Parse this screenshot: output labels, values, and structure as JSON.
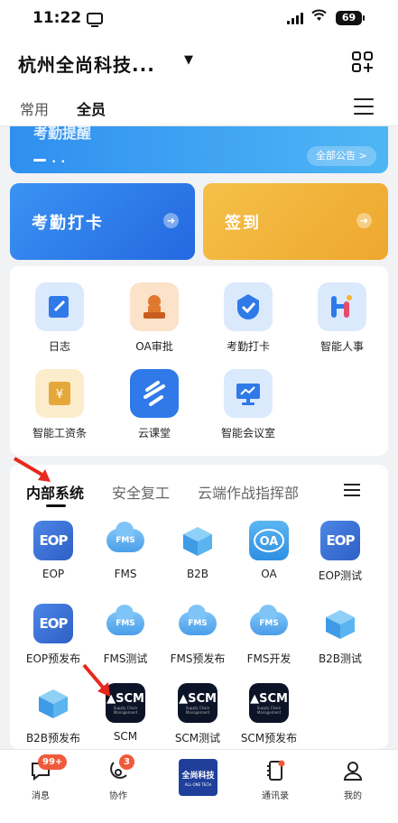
{
  "status": {
    "time": "11:22",
    "battery": "69",
    "wifi": "wifi-icon"
  },
  "header": {
    "org": "杭州全尚科技...",
    "qr_icon": "qr-add-icon"
  },
  "tabs": {
    "common": "常用",
    "all": "全员"
  },
  "banner": {
    "title": "考勤提醒",
    "all_notices": "全部公告 >"
  },
  "cards": {
    "attendance": "考勤打卡",
    "checkin": "签到",
    "arrow": "➜"
  },
  "apps": [
    {
      "label": "日志",
      "icon": "journal-icon",
      "color": "#3b82f0"
    },
    {
      "label": "OA审批",
      "icon": "stamp-icon",
      "color": "#e58a3c"
    },
    {
      "label": "考勤打卡",
      "icon": "check-shield-icon",
      "color": "#3b82f0"
    },
    {
      "label": "智能人事",
      "icon": "person-hi-icon",
      "color": "#3b82f0"
    },
    {
      "label": "智能工资条",
      "icon": "salary-icon",
      "color": "#e6b34a"
    },
    {
      "label": "云课堂",
      "icon": "cloud-class-icon",
      "color": "#3b82f0"
    },
    {
      "label": "智能会议室",
      "icon": "meeting-screen-icon",
      "color": "#3b82f0"
    }
  ],
  "systems": {
    "tabs": [
      "内部系统",
      "安全复工",
      "云端作战指挥部"
    ],
    "items": [
      {
        "label": "EOP",
        "kind": "EOP"
      },
      {
        "label": "FMS",
        "kind": "FMS"
      },
      {
        "label": "B2B",
        "kind": "B2B"
      },
      {
        "label": "OA",
        "kind": "OA"
      },
      {
        "label": "EOP测试",
        "kind": "EOP"
      },
      {
        "label": "EOP预发布",
        "kind": "EOP"
      },
      {
        "label": "FMS测试",
        "kind": "FMS"
      },
      {
        "label": "FMS预发布",
        "kind": "FMS"
      },
      {
        "label": "FMS开发",
        "kind": "FMS"
      },
      {
        "label": "B2B测试",
        "kind": "B2B"
      },
      {
        "label": "B2B预发布",
        "kind": "B2B"
      },
      {
        "label": "SCM",
        "kind": "SCM"
      },
      {
        "label": "SCM测试",
        "kind": "SCM"
      },
      {
        "label": "SCM预发布",
        "kind": "SCM"
      }
    ]
  },
  "icon_text": {
    "eop": "EOP",
    "fms": "FMS",
    "oa": "OA",
    "scm": "SCM",
    "scm_sub": "Supply Chain Management"
  },
  "tabbar": {
    "messages": "消息",
    "messages_badge": "99+",
    "collab": "协作",
    "collab_badge": "3",
    "logo_main": "全尚科技",
    "logo_sub": "ALL-ONE TECH",
    "contacts": "通讯录",
    "me": "我的"
  }
}
